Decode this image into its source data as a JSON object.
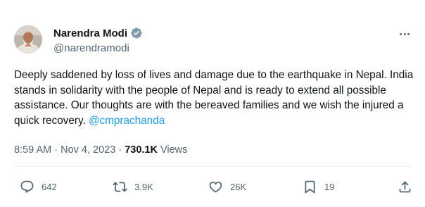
{
  "author": {
    "name": "Narendra Modi",
    "handle": "@narendramodi",
    "verified_icon": "verified-badge-icon",
    "avatar_icon": "avatar-photo"
  },
  "tweet": {
    "text": "Deeply saddened by loss of lives and damage due to the earthquake in Nepal. India stands in solidarity with the people of Nepal and is ready to extend all possible assistance. Our thoughts are with the bereaved families and we wish the injured a quick recovery. ",
    "mention": "@cmprachanda"
  },
  "meta": {
    "time": "8:59 AM",
    "separator": " · ",
    "date": "Nov 4, 2023",
    "views_count": "730.1K",
    "views_label": " Views"
  },
  "actions": {
    "replies": "642",
    "reposts": "3.9K",
    "likes": "26K",
    "bookmarks": "19"
  },
  "colors": {
    "accent": "#1d9bf0",
    "secondary_text": "#536471",
    "primary_text": "#0f1419"
  }
}
